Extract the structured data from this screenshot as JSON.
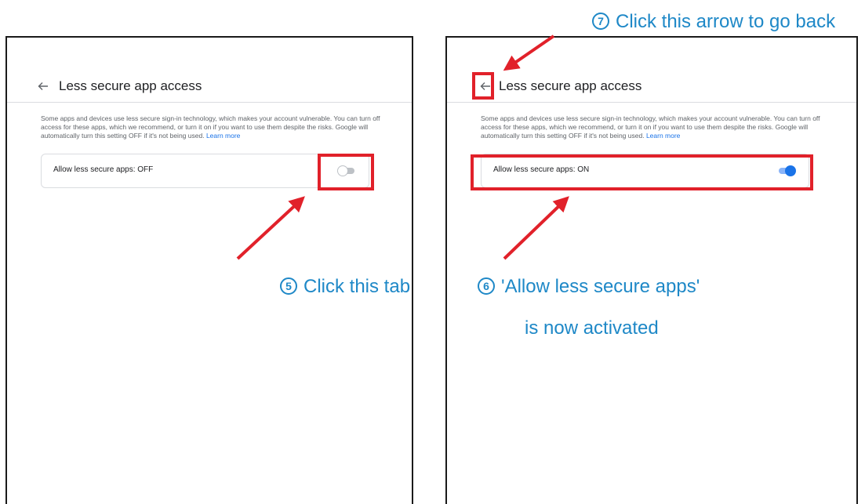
{
  "left_panel": {
    "title": "Less secure app access",
    "description": "Some apps and devices use less secure sign-in technology, which makes your account vulnerable. You can turn off access for these apps, which we recommend, or turn it on if you want to use them despite the risks. Google will automatically turn this setting OFF if it's not being used.",
    "learn_more": "Learn more",
    "setting_label": "Allow less secure apps: OFF",
    "toggle_state": "off"
  },
  "right_panel": {
    "title": "Less secure app access",
    "description": "Some apps and devices use less secure sign-in technology, which makes your account vulnerable. You can turn off access for these apps, which we recommend, or turn it on if you want to use them despite the risks. Google will automatically turn this setting OFF if it's not being used.",
    "learn_more": "Learn more",
    "setting_label": "Allow less secure apps: ON",
    "toggle_state": "on"
  },
  "annotations": {
    "step5_number": "5",
    "step5_text": "Click this tab",
    "step6_number": "6",
    "step6_line1": "'Allow less secure apps'",
    "step6_line2": "is now activated",
    "step7_number": "7",
    "step7_text": "Click this arrow to go back"
  },
  "colors": {
    "highlight": "#e1212a",
    "callout_text": "#1e88c7",
    "link": "#1a73e8",
    "toggle_on": "#1a73e8"
  },
  "icons": {
    "back": "arrow-left-icon",
    "annotation_arrow": "red-arrow-icon"
  }
}
